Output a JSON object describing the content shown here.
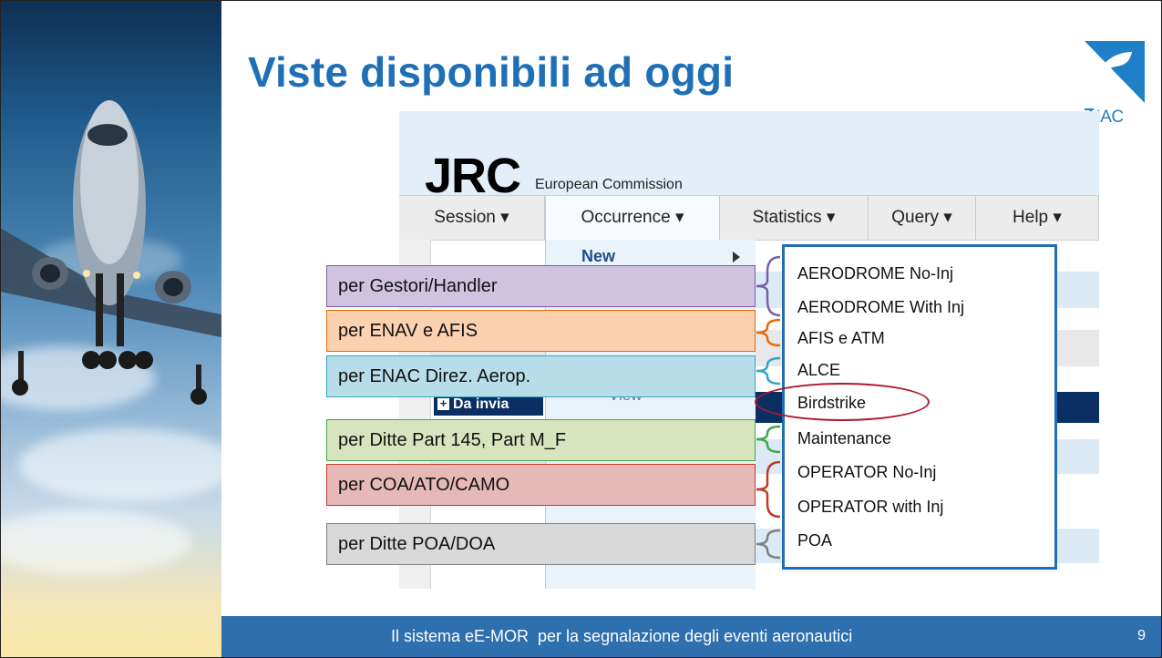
{
  "slide": {
    "title": "Viste disponibili ad oggi",
    "logo_text": "NAC",
    "footer_text": "Il sistema eE-MOR  per la segnalazione degli eventi aeronautici",
    "page_number": "9"
  },
  "app": {
    "brand": "JRC",
    "brand_sub": "European Commission",
    "menu": [
      {
        "label": "Session ▾"
      },
      {
        "label": "Occurrence ▾"
      },
      {
        "label": "Statistics ▾"
      },
      {
        "label": "Query ▾"
      },
      {
        "label": "Help ▾"
      }
    ],
    "submenu_new": "New",
    "submenu_view": "View",
    "da_invia": "Da invia"
  },
  "dropdown_items": [
    "AERODROME No-Inj",
    "AERODROME With Inj",
    "AFIS e ATM",
    "ALCE",
    "Birdstrike",
    "Maintenance",
    "OPERATOR No-Inj",
    "OPERATOR with Inj",
    "POA"
  ],
  "callouts": [
    {
      "label": "per Gestori/Handler",
      "fill": "#cfc3e0",
      "border": "#7b5ea8"
    },
    {
      "label": "per ENAV e AFIS",
      "fill": "#fbd1b0",
      "border": "#e36c0a"
    },
    {
      "label": "per ENAC Direz. Aerop.",
      "fill": "#b7dde8",
      "border": "#31a5cc"
    },
    {
      "label": "per Ditte Part 145, Part M_F",
      "fill": "#d7e4bd",
      "border": "#3fa84a"
    },
    {
      "label": "per COA/ATO/CAMO",
      "fill": "#e6b9b8",
      "border": "#c0392b"
    },
    {
      "label": "per Ditte POA/DOA",
      "fill": "#d9d9d9",
      "border": "#7f7f7f"
    }
  ],
  "colors": {
    "title": "#1f6fb7",
    "footer_bg": "#2e6fae",
    "dropdown_border": "#1f6fb7",
    "highlight_ring": "#b0182a",
    "navy": "#0c2f63"
  },
  "icons": {
    "logo": "enac-logo",
    "plus": "plus-icon",
    "arrow": "submenu-arrow-icon"
  }
}
